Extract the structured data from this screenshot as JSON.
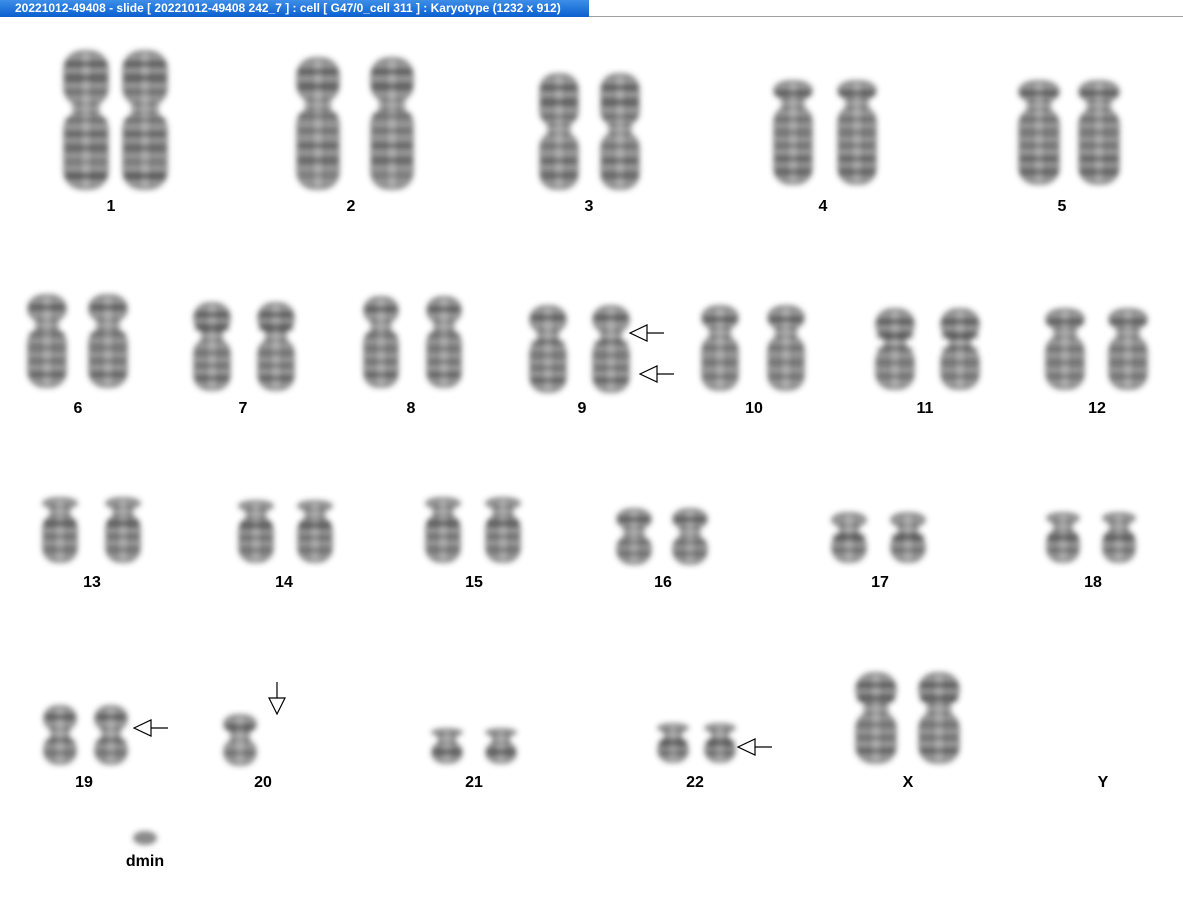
{
  "window": {
    "title": "20221012-49408 - slide [ 20221012-49408 242_7 ] : cell [ G47/0_cell 311 ] : Karyotype  (1232 x 912)"
  },
  "karyotype": {
    "chromosome_labels": {
      "c1": "1",
      "c2": "2",
      "c3": "3",
      "c4": "4",
      "c5": "5",
      "c6": "6",
      "c7": "7",
      "c8": "8",
      "c9": "9",
      "c10": "10",
      "c11": "11",
      "c12": "12",
      "c13": "13",
      "c14": "14",
      "c15": "15",
      "c16": "16",
      "c17": "17",
      "c18": "18",
      "c19": "19",
      "c20": "20",
      "c21": "21",
      "c22": "22",
      "cX": "X",
      "cY": "Y",
      "dmin": "dmin"
    },
    "colors": {
      "background": "#ffffff",
      "chromatin": "#3a3a3a",
      "arrow": "#000000"
    }
  }
}
